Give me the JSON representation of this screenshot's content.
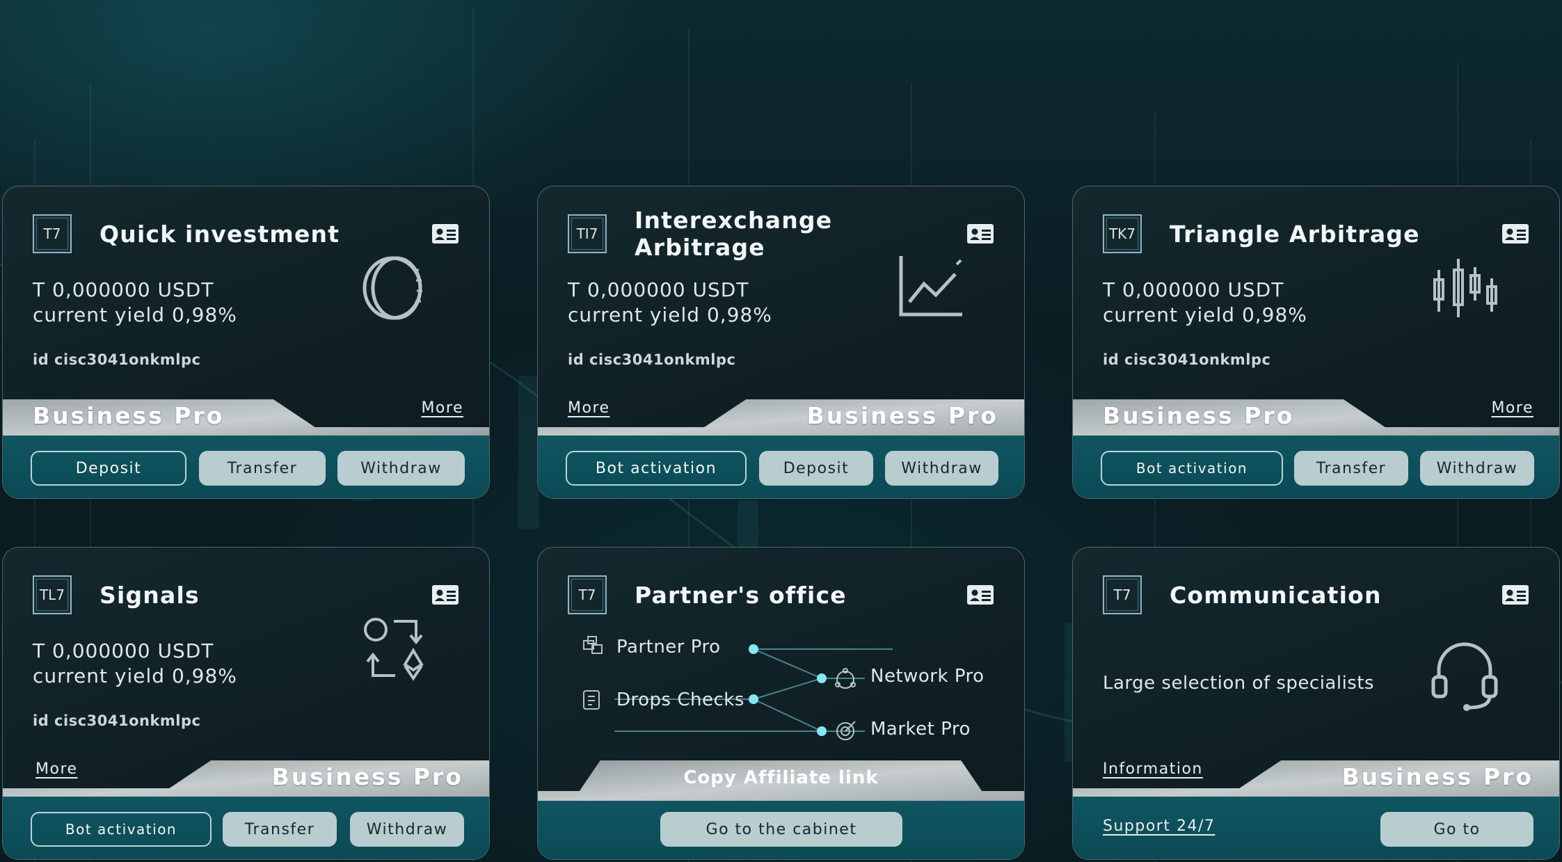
{
  "colors": {
    "accent": "#0f5560",
    "button_solid": "#b9cdd1",
    "button_outline": "#b8d5dc",
    "node": "#7fe0f0"
  },
  "cards": [
    {
      "logo": "T7",
      "title": "Quick investment",
      "balance": "T 0,000000 USDT",
      "yield": "current yield 0,98%",
      "id": "id cisc3041onkmlpc",
      "illustration": "coin-icon",
      "tier": "Business Pro",
      "more": "More",
      "buttons": [
        "Deposit",
        "Transfer",
        "Withdraw"
      ]
    },
    {
      "logo": "TI7",
      "title": "Interexchange Arbitrage",
      "balance": "T 0,000000 USDT",
      "yield": "current yield 0,98%",
      "id": "id cisc3041onkmlpc",
      "illustration": "line-chart-icon",
      "tier": "Business Pro",
      "more": "More",
      "buttons": [
        "Bot activation",
        "Deposit",
        "Withdraw"
      ]
    },
    {
      "logo": "TK7",
      "title": "Triangle Arbitrage",
      "balance": "T 0,000000 USDT",
      "yield": "current yield 0,98%",
      "id": "id cisc3041onkmlpc",
      "illustration": "candlestick-icon",
      "tier": "Business Pro",
      "more": "More",
      "buttons": [
        "Bot activation",
        "Transfer",
        "Withdraw"
      ]
    },
    {
      "logo": "TL7",
      "title": "Signals",
      "balance": "T 0,000000 USDT",
      "yield": "current yield 0,98%",
      "id": "id cisc3041onkmlpc",
      "illustration": "exchange-icon",
      "tier": "Business Pro",
      "more": "More",
      "buttons": [
        "Bot activation",
        "Transfer",
        "Withdraw"
      ]
    },
    {
      "logo": "T7",
      "title": "Partner's office",
      "partner": {
        "left": [
          "Partner Pro",
          "Drops Checks"
        ],
        "right": [
          "Network Pro",
          "Market Pro"
        ]
      },
      "copy_link": "Copy Affiliate link",
      "button": "Go to the cabinet"
    },
    {
      "logo": "T7",
      "title": "Communication",
      "description": "Large selection of specialists",
      "illustration": "headset-icon",
      "info": "Information",
      "tier": "Business Pro",
      "support": "Support 24/7",
      "button": "Go to"
    }
  ]
}
